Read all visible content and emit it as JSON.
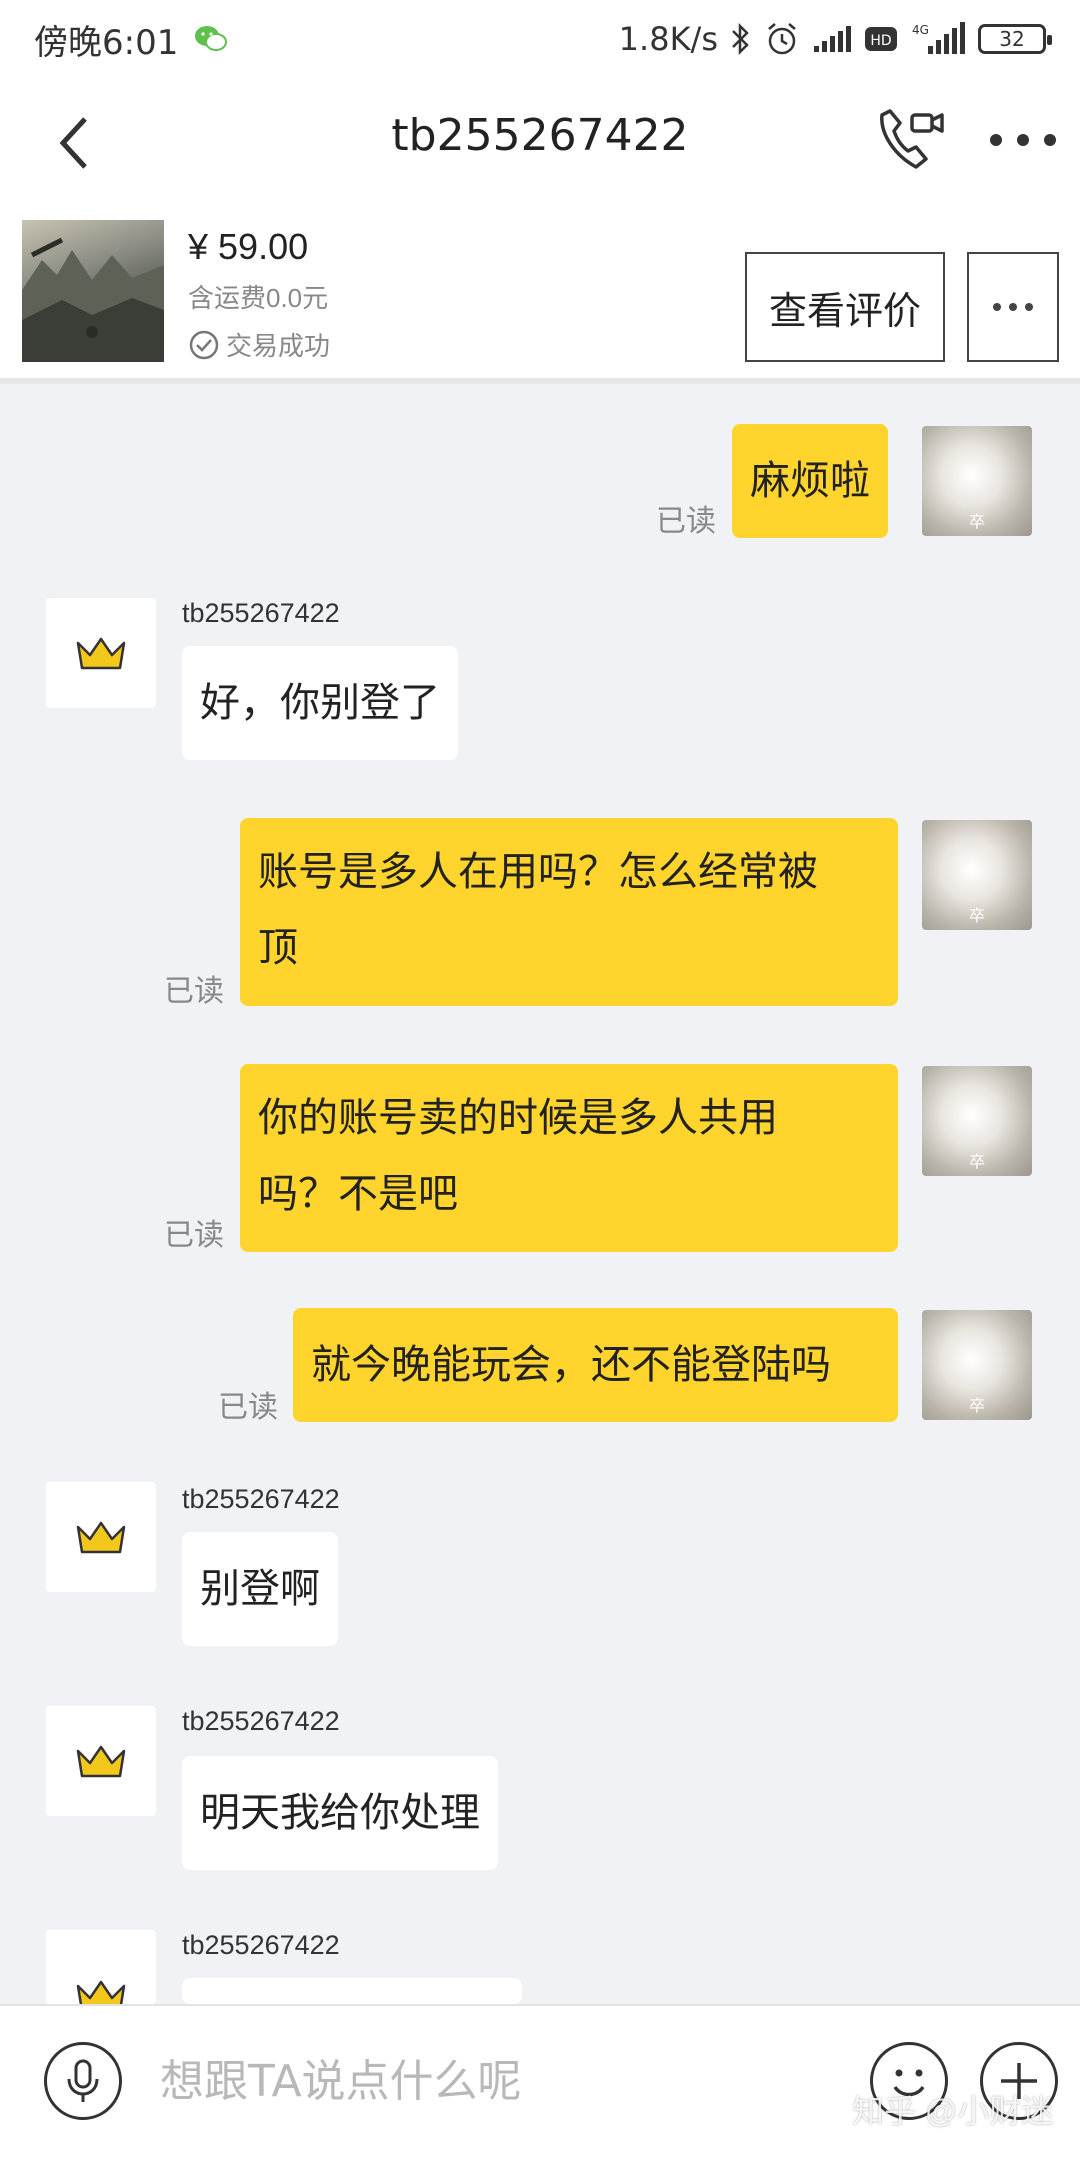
{
  "status_bar": {
    "time": "傍晚6:01",
    "speed": "1.8K/s",
    "battery": "32",
    "network": "4G"
  },
  "header": {
    "title": "tb255267422",
    "icons": {
      "back": "back-arrow-icon",
      "call": "phone-video-icon",
      "more": "more-dots-icon"
    }
  },
  "product": {
    "price": "¥ 59.00",
    "shipping": "含运费0.0元",
    "status": "交易成功",
    "review_button": "查看评价"
  },
  "chat": {
    "read_label": "已读",
    "me_avatar_tag": "卒",
    "messages": [
      {
        "from": "me",
        "lines": [
          "麻烦啦"
        ]
      },
      {
        "from": "seller",
        "sender": "tb255267422",
        "lines": [
          "好，你别登了"
        ]
      },
      {
        "from": "me",
        "lines": [
          "账号是多人在用吗？怎么经常被",
          "顶"
        ]
      },
      {
        "from": "me",
        "lines": [
          "你的账号卖的时候是多人共用",
          "吗？不是吧"
        ]
      },
      {
        "from": "me",
        "lines": [
          "就今晚能玩会，还不能登陆吗"
        ]
      },
      {
        "from": "seller",
        "sender": "tb255267422",
        "lines": [
          "别登啊"
        ]
      },
      {
        "from": "seller",
        "sender": "tb255267422",
        "lines": [
          "明天我给你处理"
        ]
      },
      {
        "from": "seller",
        "sender": "tb255267422",
        "lines": [
          ""
        ]
      }
    ]
  },
  "input_bar": {
    "placeholder": "想跟TA说点什么呢"
  },
  "watermark": "知乎 @小财迷",
  "colors": {
    "outgoing_bubble": "#fed42d",
    "incoming_bubble": "#ffffff",
    "chat_background": "#f1f2f6",
    "crown": "#f2c81c"
  }
}
